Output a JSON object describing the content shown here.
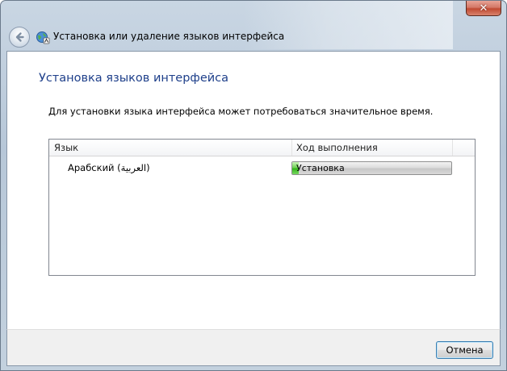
{
  "window": {
    "title": "Установка или удаление языков интерфейса",
    "close_glyph": "✕"
  },
  "page": {
    "heading": "Установка языков интерфейса",
    "description": "Для установки языка интерфейса может потребоваться значительное время."
  },
  "list": {
    "columns": [
      "Язык",
      "Ход выполнения"
    ],
    "rows": [
      {
        "language": "Арабский (العربية)",
        "status": "Установка",
        "progress": 0.04
      }
    ]
  },
  "footer": {
    "cancel_label": "Отмена"
  },
  "colors": {
    "heading": "#1e3f8a",
    "progress_fill": "#34b41a"
  },
  "icons": {
    "back": "back-arrow-icon",
    "app": "globe-language-icon",
    "close": "close-icon"
  }
}
